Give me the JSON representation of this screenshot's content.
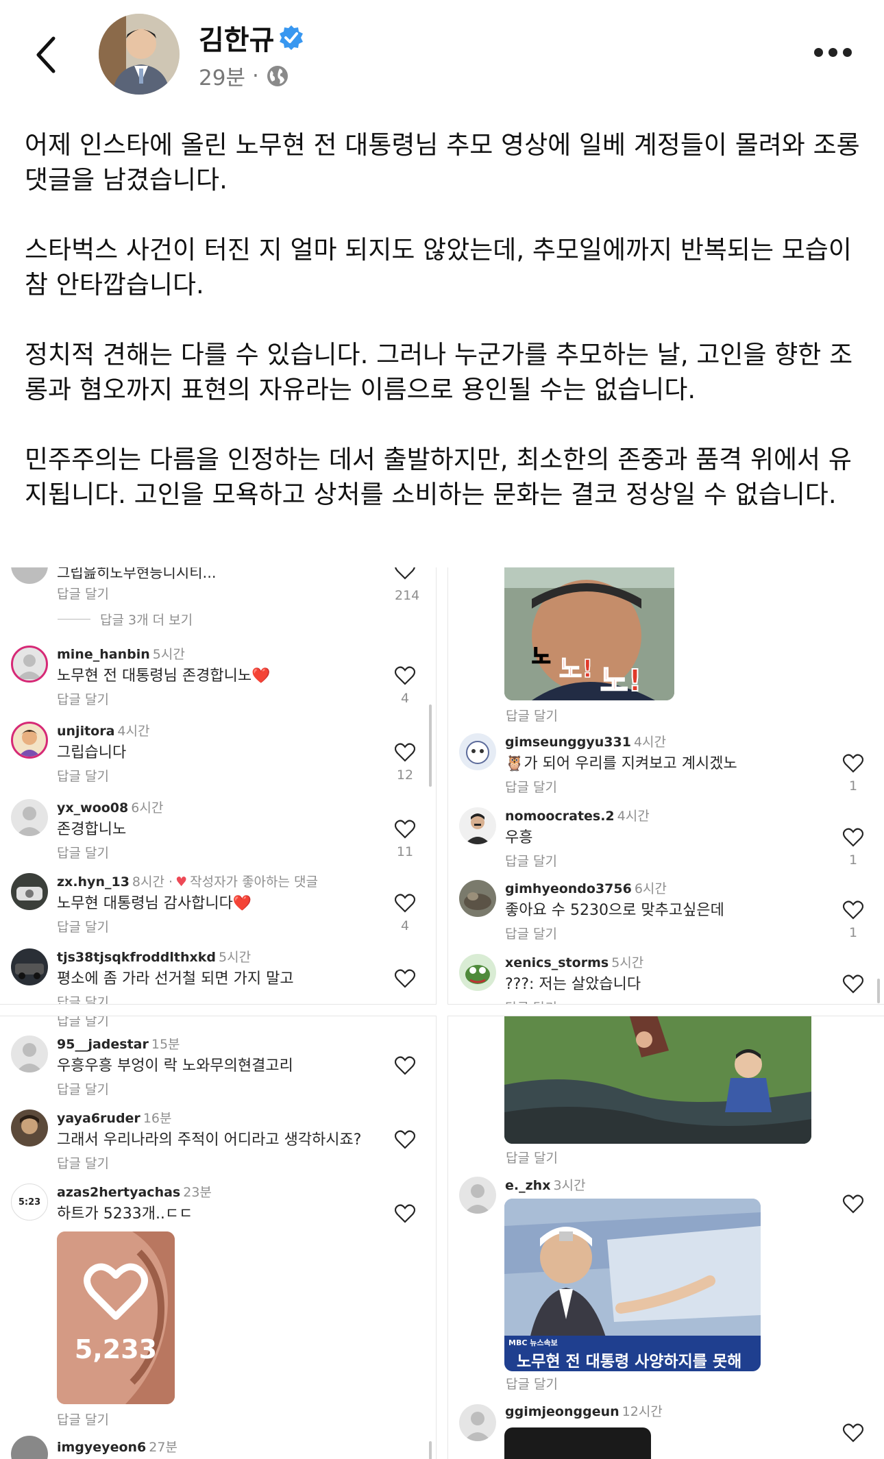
{
  "header": {
    "author": "김한규",
    "time": "29분",
    "separator": "·"
  },
  "post": {
    "paragraphs": [
      "어제 인스타에 올린 노무현 전 대통령님 추모 영상에 일베 계정들이 몰려와 조롱 댓글을 남겼습니다.",
      "스타벅스 사건이 터진 지 얼마 되지도 않았는데, 추모일에까지 반복되는 모습이 참 안타깝습니다.",
      "정치적 견해는 다를 수 있습니다. 그러나 누군가를 추모하는 날, 고인을 향한 조롱과 혐오까지 표현의 자유라는 이름으로 용인될 수는 없습니다.",
      "민주주의는 다름을 인정하는 데서 출발하지만, 최소한의 존중과 품격 위에서 유지됩니다. 고인을 모욕하고 상처를 소비하는 문화는 결코 정상일 수 없습니다."
    ]
  },
  "screenshots": {
    "reply_label": "답글 달기",
    "top_left": {
      "top_cut_text": "그립읊히노무현등니시티...",
      "top_count": "214",
      "more_replies": "답글 3개 더 보기",
      "comments": [
        {
          "user": "mine_hanbin",
          "time": "5시간",
          "text": "노무현 전 대통령님 존경합니노❤️",
          "count": "4"
        },
        {
          "user": "unjitora",
          "time": "4시간",
          "text": "그립습니다",
          "count": "12"
        },
        {
          "user": "yx_woo08",
          "time": "6시간",
          "text": "존경합니노",
          "count": "11"
        },
        {
          "user": "zx.hyn_13",
          "time": "8시간 ·",
          "liked": "작성자가 좋아하는 댓글",
          "text": "노무현 대통령님 감사합니다❤️",
          "count": "4"
        },
        {
          "user": "tjs38tjsqkfroddlthxkd",
          "time": "5시간",
          "text": "평소에 좀 가라 선거철 되면 가지 말고",
          "count": ""
        }
      ]
    },
    "top_right": {
      "comments": [
        {
          "user": "gimseunggyu331",
          "time": "4시간",
          "text": "🦉가 되어 우리를 지켜보고 계시겠노",
          "count": "1"
        },
        {
          "user": "nomoocrates.2",
          "time": "4시간",
          "text": "우흥",
          "count": "1"
        },
        {
          "user": "gimhyeondo3756",
          "time": "6시간",
          "text": "좋아요 수 5230으로 맞추고싶은데",
          "count": "1"
        },
        {
          "user": "xenics_storms",
          "time": "5시간",
          "text": "???: 저는 살았습니다",
          "count": ""
        }
      ]
    },
    "bottom_left": {
      "avatar_clock": "5:23",
      "image_count": "5,233",
      "comments": [
        {
          "user": "95__jadestar",
          "time": "15분",
          "text": "우흥우흥 부엉이 락 노와무의현결고리"
        },
        {
          "user": "yaya6ruder",
          "time": "16분",
          "text": "그래서 우리나라의 주적이 어디라고 생각하시죠?"
        },
        {
          "user": "azas2hertyachas",
          "time": "23분",
          "text": "하트가 5233개..ㄷㄷ"
        },
        {
          "user": "imgyeyeon6",
          "time": "27분",
          "text": ""
        }
      ]
    },
    "bottom_right": {
      "caption_logo": "MBC 뉴스속보",
      "caption": "노무현 전 대통령 사양하지를 못해",
      "comments": [
        {
          "user": "e._zhx",
          "time": "3시간"
        },
        {
          "user": "ggimjeonggeun",
          "time": "12시간"
        }
      ]
    }
  },
  "colors": {
    "verified": "#3897f0",
    "heart_red": "#ed4956",
    "muted": "#8e8e8e"
  }
}
